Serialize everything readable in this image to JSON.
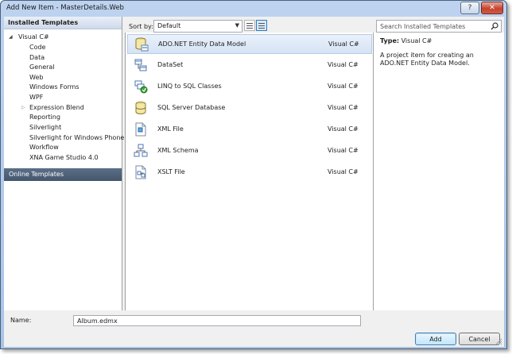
{
  "window": {
    "title": "Add New Item - MasterDetails.Web",
    "help_label": "?",
    "close_label": "✕"
  },
  "left": {
    "installed_header": "Installed Templates",
    "root": "Visual C#",
    "children": [
      "Code",
      "Data",
      "General",
      "Web",
      "Windows Forms",
      "WPF",
      "Expression Blend",
      "Reporting",
      "Silverlight",
      "Silverlight for Windows Phone",
      "Workflow",
      "XNA Game Studio 4.0"
    ],
    "selected": "Data",
    "online_header": "Online Templates"
  },
  "toolbar": {
    "sort_label": "Sort by:",
    "sort_value": "Default",
    "search_placeholder": "Search Installed Templates"
  },
  "items": [
    {
      "name": "ADO.NET Entity Data Model",
      "lang": "Visual C#",
      "icon": "entity-model-icon"
    },
    {
      "name": "DataSet",
      "lang": "Visual C#",
      "icon": "dataset-icon"
    },
    {
      "name": "LINQ to SQL Classes",
      "lang": "Visual C#",
      "icon": "linq-to-sql-icon"
    },
    {
      "name": "SQL Server Database",
      "lang": "Visual C#",
      "icon": "sql-database-icon"
    },
    {
      "name": "XML File",
      "lang": "Visual C#",
      "icon": "xml-file-icon"
    },
    {
      "name": "XML Schema",
      "lang": "Visual C#",
      "icon": "xml-schema-icon"
    },
    {
      "name": "XSLT File",
      "lang": "Visual C#",
      "icon": "xslt-file-icon"
    }
  ],
  "detail": {
    "type_label": "Type:",
    "type_value": "Visual C#",
    "description": "A project item for creating an ADO.NET Entity Data Model."
  },
  "bottom": {
    "name_label": "Name:",
    "name_value": "Album.edmx",
    "add_label": "Add",
    "cancel_label": "Cancel"
  },
  "colors": {
    "selection": "#d5e3f5",
    "online_header": "#4a5d75",
    "dialog_frame": "#b4cdec"
  }
}
